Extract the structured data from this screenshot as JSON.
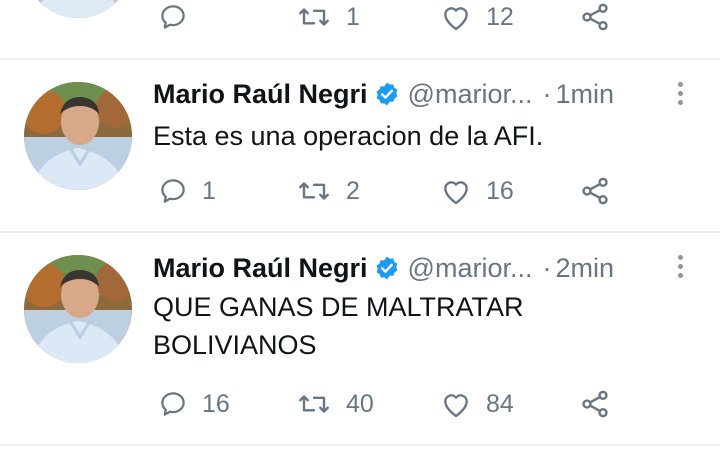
{
  "top_partial": {
    "actions": {
      "reply": "",
      "retweet": "1",
      "like": "12"
    }
  },
  "tweets": [
    {
      "name": "Mario Raúl Negri",
      "handle": "@marior...",
      "separator": "·",
      "time": "1min",
      "text": "Esta es una operacion de la AFI.",
      "actions": {
        "reply": "1",
        "retweet": "2",
        "like": "16"
      }
    },
    {
      "name": "Mario Raúl Negri",
      "handle": "@marior...",
      "separator": "·",
      "time": "2min",
      "text": "QUE GANAS DE MALTRATAR\nBOLIVIANOS",
      "actions": {
        "reply": "16",
        "retweet": "40",
        "like": "84"
      }
    }
  ],
  "colors": {
    "verified": "#1d9bf0",
    "secondary_text": "#687684",
    "divider": "#eceef0"
  },
  "icons": [
    "reply-icon",
    "retweet-icon",
    "like-icon",
    "share-icon",
    "verified-badge-icon",
    "more-options-icon"
  ]
}
